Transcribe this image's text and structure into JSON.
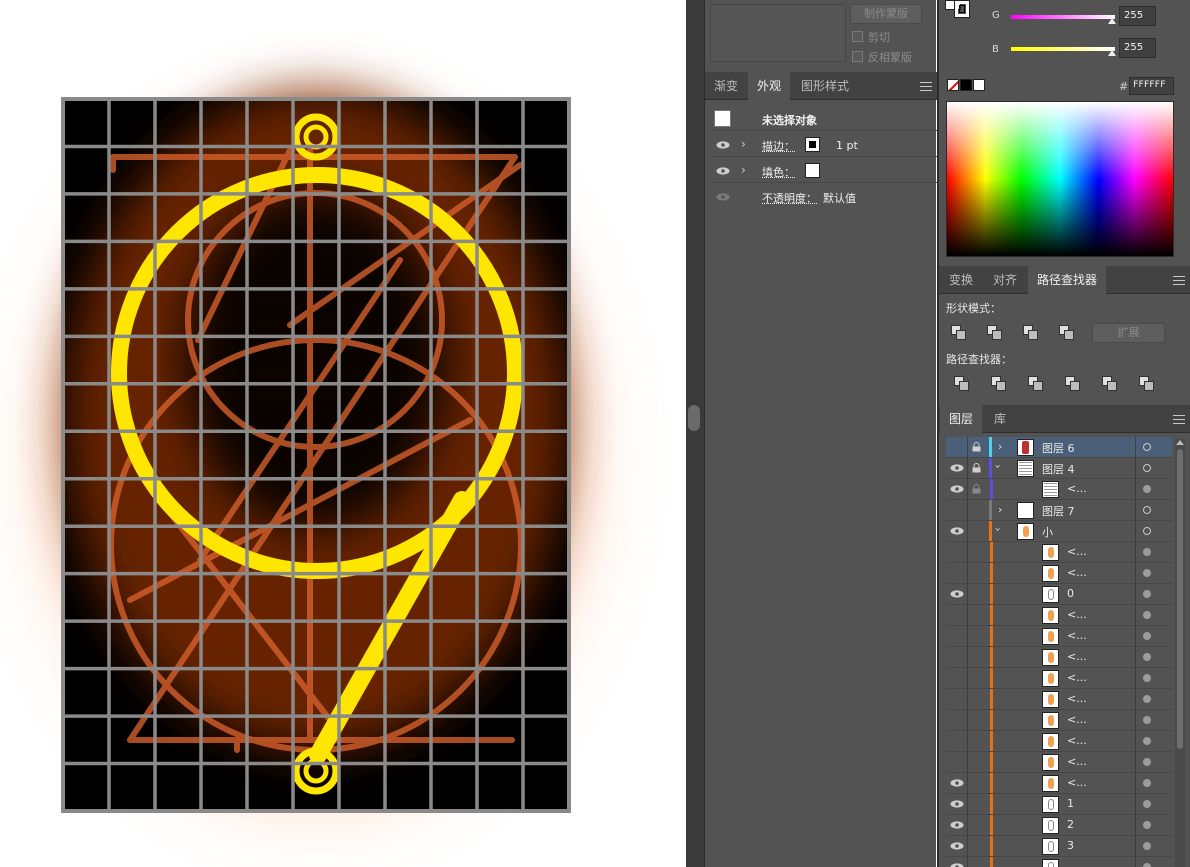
{
  "top_mask": {
    "make_mask_label": "制作蒙版",
    "clip_label": "剪切",
    "invert_mask_label": "反相蒙版"
  },
  "appearance_panel": {
    "tabs": [
      {
        "label": "渐变",
        "active": false
      },
      {
        "label": "外观",
        "active": true
      },
      {
        "label": "图形样式",
        "active": false
      }
    ],
    "no_selection_label": "未选择对象",
    "stroke_label": "描边：",
    "stroke_value": "1 pt",
    "fill_label": "填色：",
    "opacity_label": "不透明度：",
    "opacity_value": "默认值"
  },
  "color_panel": {
    "g_label": "G",
    "g_value": "255",
    "b_label": "B",
    "b_value": "255",
    "hex_prefix": "#",
    "hex_value": "FFFFFF",
    "g_color": "#ff00ff",
    "b_color": "#ffff00"
  },
  "pathfinder_panel": {
    "tabs": [
      {
        "label": "变换",
        "active": false
      },
      {
        "label": "对齐",
        "active": false
      },
      {
        "label": "路径查找器",
        "active": true
      }
    ],
    "shape_modes_label": "形状模式：",
    "expand_label": "扩展",
    "pathfinders_label": "路径查找器："
  },
  "layers_panel": {
    "tabs": [
      {
        "label": "图层",
        "active": true
      },
      {
        "label": "库",
        "active": false
      }
    ],
    "layers": [
      {
        "name": "图层 6",
        "eye": false,
        "lock": true,
        "expand": ">",
        "level": 0,
        "color": "#4fd2f0",
        "selected": true,
        "filled": false,
        "thumb": "art"
      },
      {
        "name": "图层 4",
        "eye": true,
        "lock": true,
        "expand": "v",
        "level": 0,
        "color": "#5a4fe0",
        "selected": false,
        "filled": false,
        "thumb": "grid"
      },
      {
        "name": "<...",
        "eye": true,
        "lock": true,
        "expand": "",
        "level": 1,
        "color": "#5a4fe0",
        "selected": false,
        "filled": true,
        "thumb": "grid"
      },
      {
        "name": "图层 7",
        "eye": false,
        "lock": false,
        "expand": ">",
        "level": 0,
        "color": "#7a7a7a",
        "selected": false,
        "filled": false,
        "thumb": "blank"
      },
      {
        "name": "小",
        "eye": true,
        "lock": false,
        "expand": "v",
        "level": 0,
        "color": "#e8701a",
        "selected": false,
        "filled": false,
        "thumb": "glyph"
      },
      {
        "name": "<...",
        "eye": false,
        "lock": false,
        "expand": "",
        "level": 1,
        "color": "#e8701a",
        "selected": false,
        "filled": true,
        "thumb": "glyph"
      },
      {
        "name": "<...",
        "eye": false,
        "lock": false,
        "expand": "",
        "level": 1,
        "color": "#e8701a",
        "selected": false,
        "filled": true,
        "thumb": "glyph"
      },
      {
        "name": "0",
        "eye": true,
        "lock": false,
        "expand": "",
        "level": 1,
        "color": "#e8701a",
        "selected": false,
        "filled": true,
        "thumb": "outline"
      },
      {
        "name": "<...",
        "eye": false,
        "lock": false,
        "expand": "",
        "level": 1,
        "color": "#e8701a",
        "selected": false,
        "filled": true,
        "thumb": "glyph"
      },
      {
        "name": "<...",
        "eye": false,
        "lock": false,
        "expand": "",
        "level": 1,
        "color": "#e8701a",
        "selected": false,
        "filled": true,
        "thumb": "glyph"
      },
      {
        "name": "<...",
        "eye": false,
        "lock": false,
        "expand": "",
        "level": 1,
        "color": "#e8701a",
        "selected": false,
        "filled": true,
        "thumb": "glyph"
      },
      {
        "name": "<...",
        "eye": false,
        "lock": false,
        "expand": "",
        "level": 1,
        "color": "#e8701a",
        "selected": false,
        "filled": true,
        "thumb": "glyph"
      },
      {
        "name": "<...",
        "eye": false,
        "lock": false,
        "expand": "",
        "level": 1,
        "color": "#e8701a",
        "selected": false,
        "filled": true,
        "thumb": "glyph"
      },
      {
        "name": "<...",
        "eye": false,
        "lock": false,
        "expand": "",
        "level": 1,
        "color": "#e8701a",
        "selected": false,
        "filled": true,
        "thumb": "glyph"
      },
      {
        "name": "<...",
        "eye": false,
        "lock": false,
        "expand": "",
        "level": 1,
        "color": "#e8701a",
        "selected": false,
        "filled": true,
        "thumb": "glyph"
      },
      {
        "name": "<...",
        "eye": false,
        "lock": false,
        "expand": "",
        "level": 1,
        "color": "#e8701a",
        "selected": false,
        "filled": true,
        "thumb": "glyph"
      },
      {
        "name": "<...",
        "eye": true,
        "lock": false,
        "expand": "",
        "level": 1,
        "color": "#e8701a",
        "selected": false,
        "filled": true,
        "thumb": "glyph"
      },
      {
        "name": "1",
        "eye": true,
        "lock": false,
        "expand": "",
        "level": 1,
        "color": "#e8701a",
        "selected": false,
        "filled": true,
        "thumb": "outline"
      },
      {
        "name": "2",
        "eye": true,
        "lock": false,
        "expand": "",
        "level": 1,
        "color": "#e8701a",
        "selected": false,
        "filled": true,
        "thumb": "outline"
      },
      {
        "name": "3",
        "eye": true,
        "lock": false,
        "expand": "",
        "level": 1,
        "color": "#e8701a",
        "selected": false,
        "filled": true,
        "thumb": "outline"
      },
      {
        "name": "",
        "eye": true,
        "lock": false,
        "expand": "",
        "level": 1,
        "color": "#e8701a",
        "selected": false,
        "filled": true,
        "thumb": "outline"
      }
    ]
  }
}
